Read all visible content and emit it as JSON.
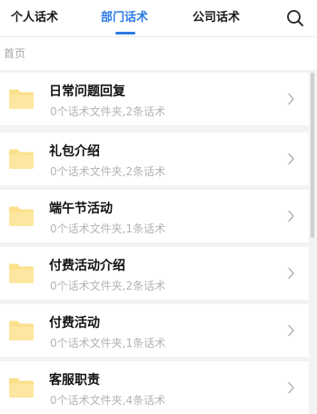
{
  "tabs": [
    {
      "label": "个人话术",
      "active": false
    },
    {
      "label": "部门话术",
      "active": true
    },
    {
      "label": "公司话术",
      "active": false
    }
  ],
  "search_icon": "search-icon",
  "breadcrumb": "首页",
  "colors": {
    "accent": "#2d7be5",
    "folder": "#fbe08c",
    "meta_text": "#b3b3b3"
  },
  "folders": [
    {
      "name": "日常问题回复",
      "meta": "0个话术文件夹,2条话术"
    },
    {
      "name": "礼包介绍",
      "meta": "0个话术文件夹,2条话术"
    },
    {
      "name": "端午节活动",
      "meta": "0个话术文件夹,1条话术"
    },
    {
      "name": "付费活动介绍",
      "meta": "0个话术文件夹,2条话术"
    },
    {
      "name": "付费活动",
      "meta": "0个话术文件夹,1条话术"
    },
    {
      "name": "客服职责",
      "meta": "0个话术文件夹,4条话术"
    }
  ]
}
